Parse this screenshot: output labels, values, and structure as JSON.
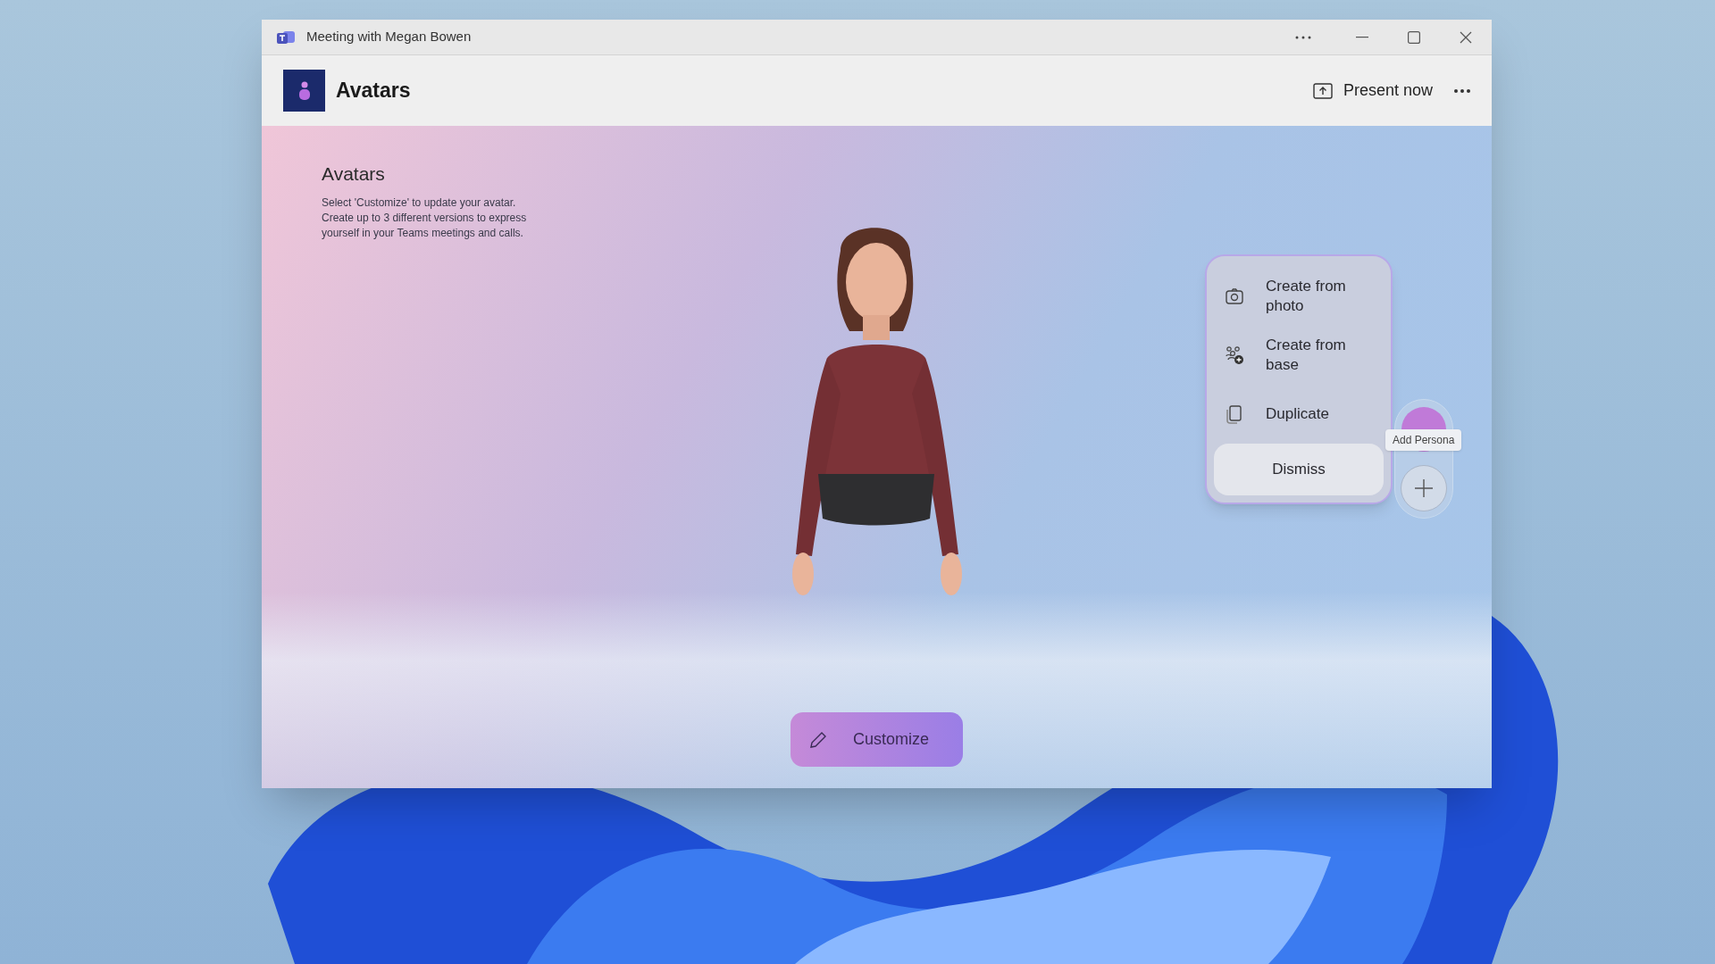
{
  "window": {
    "title": "Meeting with Megan Bowen"
  },
  "header": {
    "title": "Avatars",
    "present_button": "Present now"
  },
  "intro": {
    "title": "Avatars",
    "description": "Select 'Customize' to update your avatar. Create up to 3 different versions to express yourself in your Teams meetings and calls."
  },
  "menu": {
    "items": [
      {
        "label": "Create from photo",
        "kind": "camera"
      },
      {
        "label": "Create from base",
        "kind": "people"
      },
      {
        "label": "Duplicate",
        "kind": "copy"
      }
    ],
    "dismiss": "Dismiss"
  },
  "persona": {
    "tooltip": "Add Persona"
  },
  "customize_button": "Customize"
}
